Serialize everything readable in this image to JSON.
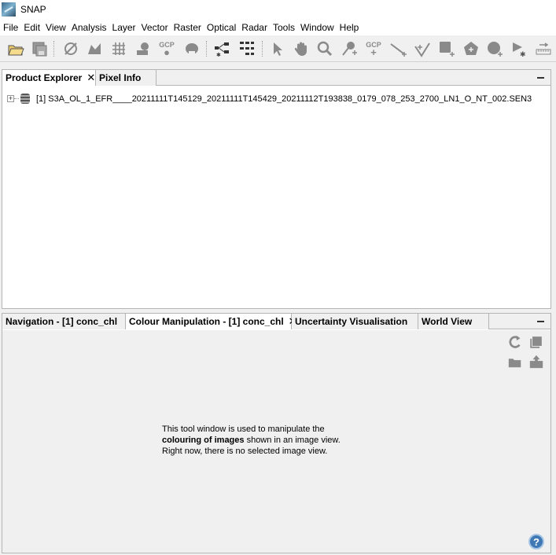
{
  "window": {
    "title": "SNAP"
  },
  "menu": [
    "File",
    "Edit",
    "View",
    "Analysis",
    "Layer",
    "Vector",
    "Raster",
    "Optical",
    "Radar",
    "Tools",
    "Window",
    "Help"
  ],
  "toolbar": {
    "icons": [
      "open-product-icon",
      "save-product-icon",
      "no-data-overlay-icon",
      "world-map-overlay-icon",
      "graticule-overlay-icon",
      "pin-manager-icon",
      "gcp-manager-icon",
      "mask-manager-icon",
      "graph-builder-icon",
      "batch-processing-icon",
      "select-tool-icon",
      "pan-tool-icon",
      "zoom-tool-icon",
      "pin-placing-tool-icon",
      "gcp-placing-tool-icon",
      "line-drawing-tool-icon",
      "polyline-drawing-tool-icon",
      "rectangle-drawing-tool-icon",
      "polygon-drawing-tool-icon",
      "ellipse-drawing-tool-icon",
      "magic-wand-tool-icon",
      "range-finder-tool-icon"
    ],
    "gcp_label": "GCP"
  },
  "top_panel": {
    "tabs": [
      {
        "label": "Product Explorer",
        "closable": true
      },
      {
        "label": "Pixel Info",
        "closable": false
      }
    ],
    "tree_item": "[1] S3A_OL_1_EFR____20211111T145129_20211111T145429_20211112T193838_0179_078_253_2700_LN1_O_NT_002.SEN3"
  },
  "bottom_panel": {
    "tabs": [
      {
        "label": "Navigation - [1] conc_chl",
        "closable": false
      },
      {
        "label": "Colour Manipulation - [1] conc_chl",
        "closable": true
      },
      {
        "label": "Uncertainty Visualisation",
        "closable": false
      },
      {
        "label": "World View",
        "closable": false
      }
    ],
    "message": {
      "line1": "This tool window is used to manipulate the",
      "bold": "colouring of images",
      "line2_rest": " shown in an image view.",
      "line3": "Right now, there is no selected image view."
    }
  },
  "close_glyph": "✕",
  "expand_glyph": "+",
  "help_glyph": "?"
}
